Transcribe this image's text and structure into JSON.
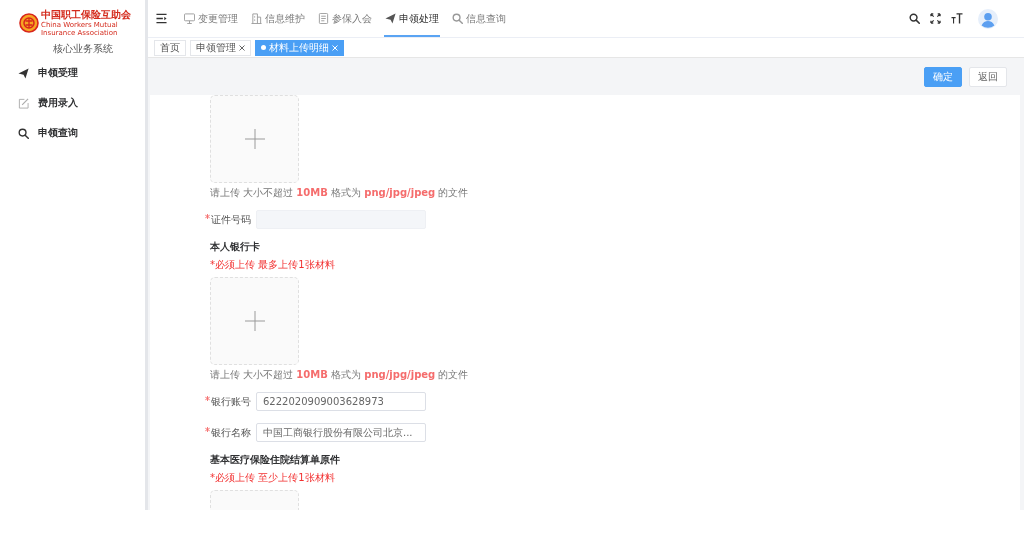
{
  "sidebar": {
    "logo": {
      "name": "中国职工保险互助会",
      "subtitle": "China Workers Mutual Insurance Association"
    },
    "system_name": "核心业务系统",
    "items": [
      {
        "label": "申领受理"
      },
      {
        "label": "费用录入"
      },
      {
        "label": "申领查询"
      }
    ]
  },
  "header": {
    "nav": [
      {
        "label": "变更管理",
        "selected": false
      },
      {
        "label": "信息维护",
        "selected": false
      },
      {
        "label": "参保入会",
        "selected": false
      },
      {
        "label": "申领处理",
        "selected": true
      },
      {
        "label": "信息查询",
        "selected": false
      }
    ]
  },
  "tabs": [
    {
      "label": "首页",
      "closable": false,
      "selected": false
    },
    {
      "label": "申领管理",
      "closable": true,
      "selected": false
    },
    {
      "label": "材料上传明细",
      "closable": true,
      "selected": true
    }
  ],
  "toolbar": {
    "buttons": [
      {
        "label": "确定",
        "kind": "primary"
      },
      {
        "label": "返回",
        "kind": "default"
      }
    ]
  },
  "form": {
    "items": [
      {
        "kind": "upload",
        "hint": "请上传 大小不超过 **10MB** 格式为 **png/jpg/jpeg** 的文件"
      },
      {
        "kind": "field",
        "label": "证件号码",
        "required": true,
        "disabled": true
      },
      {
        "kind": "heading",
        "text": "本人银行卡"
      },
      {
        "kind": "notice",
        "text": "*必须上传 最多上传1张材料"
      },
      {
        "kind": "upload",
        "hint": "请上传 大小不超过 **10MB** 格式为 **png/jpg/jpeg** 的文件"
      },
      {
        "kind": "field",
        "label": "银行账号",
        "required": true,
        "disabled": false,
        "value": "6222020909003628973"
      },
      {
        "kind": "field",
        "label": "银行名称",
        "required": true,
        "disabled": false,
        "value": "中国工商银行股份有限公司北京..."
      },
      {
        "kind": "heading",
        "text": "基本医疗保险住院结算单原件"
      },
      {
        "kind": "notice",
        "text": "*必须上传 至少上传1张材料"
      },
      {
        "kind": "upload"
      }
    ]
  }
}
